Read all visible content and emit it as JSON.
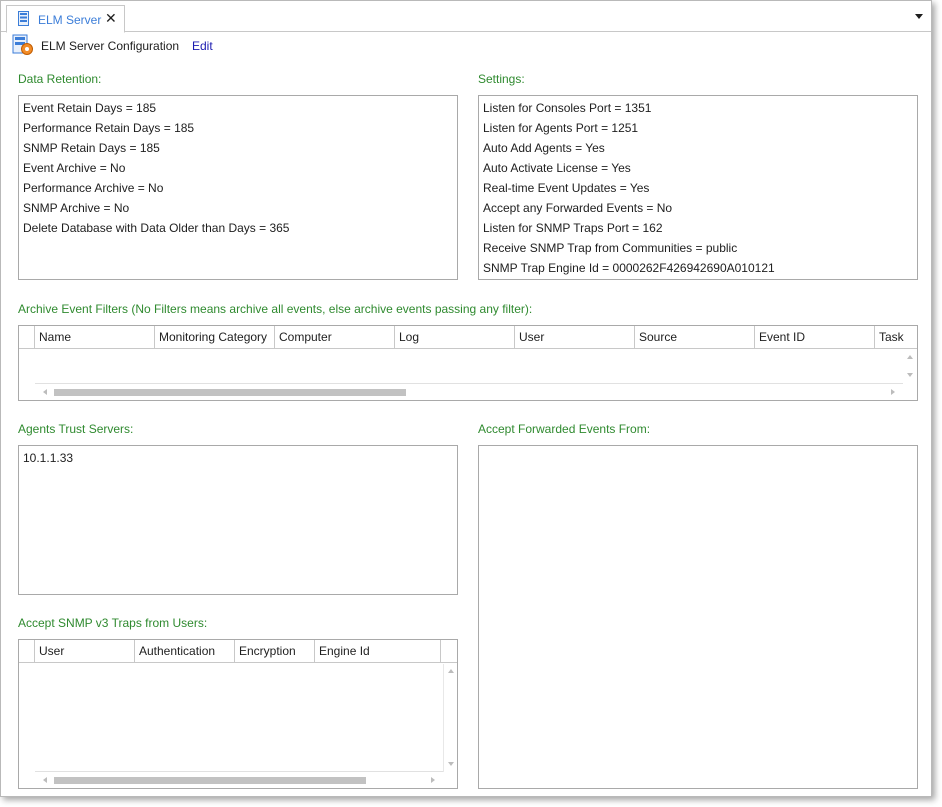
{
  "tab": {
    "title": "ELM Server",
    "close_glyph": "✕",
    "icon": "server-icon"
  },
  "toolbar": {
    "title": "ELM Server Configuration",
    "edit_label": "Edit",
    "icon": "server-config-icon"
  },
  "data_retention": {
    "label": "Data Retention:",
    "items": [
      "Event Retain Days = 185",
      "Performance Retain Days = 185",
      "SNMP Retain Days = 185",
      "Event Archive = No",
      "Performance Archive = No",
      "SNMP Archive = No",
      "Delete Database with Data Older than Days = 365"
    ]
  },
  "settings": {
    "label": "Settings:",
    "items": [
      "Listen for Consoles Port = 1351",
      "Listen for Agents Port = 1251",
      "Auto Add Agents = Yes",
      "Auto Activate License = Yes",
      "Real-time Event Updates = Yes",
      "Accept any Forwarded Events = No",
      "Listen for SNMP Traps Port = 162",
      "Receive SNMP Trap from Communities = public",
      "SNMP Trap Engine Id = 0000262F426942690A010121"
    ]
  },
  "archive_filters": {
    "label": "Archive Event Filters (No Filters means archive all events, else archive events passing any filter):",
    "columns": [
      "Name",
      "Monitoring Category",
      "Computer",
      "Log",
      "User",
      "Source",
      "Event ID",
      "Task"
    ]
  },
  "agents_trust": {
    "label": "Agents Trust Servers:",
    "items": [
      "10.1.1.33"
    ]
  },
  "accept_forwarded": {
    "label": "Accept Forwarded Events From:",
    "items": []
  },
  "snmp_v3": {
    "label": "Accept SNMP v3 Traps from Users:",
    "columns": [
      "User",
      "Authentication",
      "Encryption",
      "Engine Id"
    ]
  },
  "colors": {
    "section_label": "#2f8a2f",
    "tab_title": "#3b7dd8",
    "link": "#1a1ab0",
    "border": "#a9a9a9"
  }
}
